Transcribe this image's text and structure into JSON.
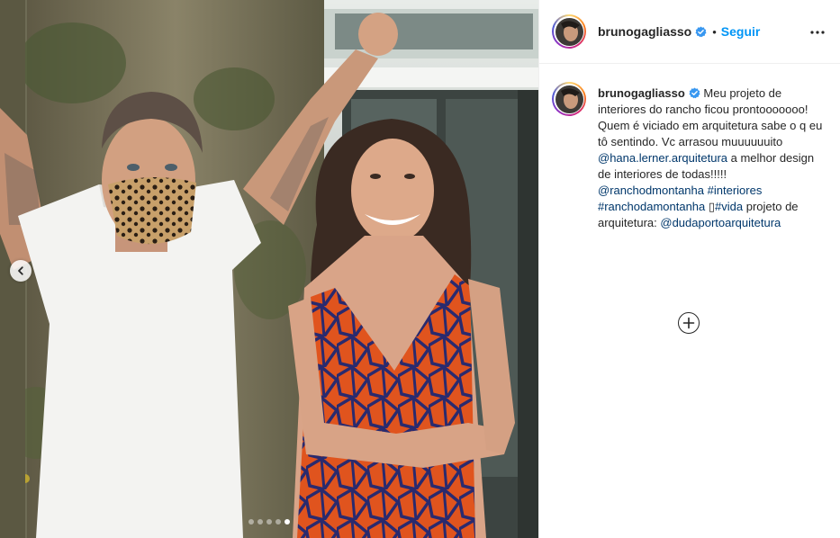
{
  "header": {
    "username": "brunogagliasso",
    "bullet": "•",
    "follow_label": "Seguir"
  },
  "caption": {
    "username": "brunogagliasso",
    "text_1": "Meu projeto de interiores do rancho ficou prontooooooo! Quem é viciado em arquitetura sabe o q eu tô sentindo. Vc arrasou muuuuuuito ",
    "mention_1": "@hana.lerner.arquitetura",
    "text_2": " a melhor design de interiores de todas!!!!! ",
    "mention_2": "@ranchodmontanha",
    "hashtag_1": "#interiores",
    "hashtag_2": "#ranchodamontanha",
    "symbol": " ▯",
    "hashtag_3": "#vida",
    "text_3": " projeto de arquitetura: ",
    "mention_3": "@dudaportoarquitetura"
  },
  "carousel": {
    "total": 5,
    "active_index": 4
  },
  "icons": {
    "prev": "chevron-left-icon",
    "verified": "verified-badge-icon",
    "more": "more-options-icon",
    "load_more": "plus-circle-icon"
  },
  "colors": {
    "accent_blue": "#0095f6",
    "link_blue": "#00376b",
    "verified_blue": "#3897f0",
    "text": "#262626"
  }
}
